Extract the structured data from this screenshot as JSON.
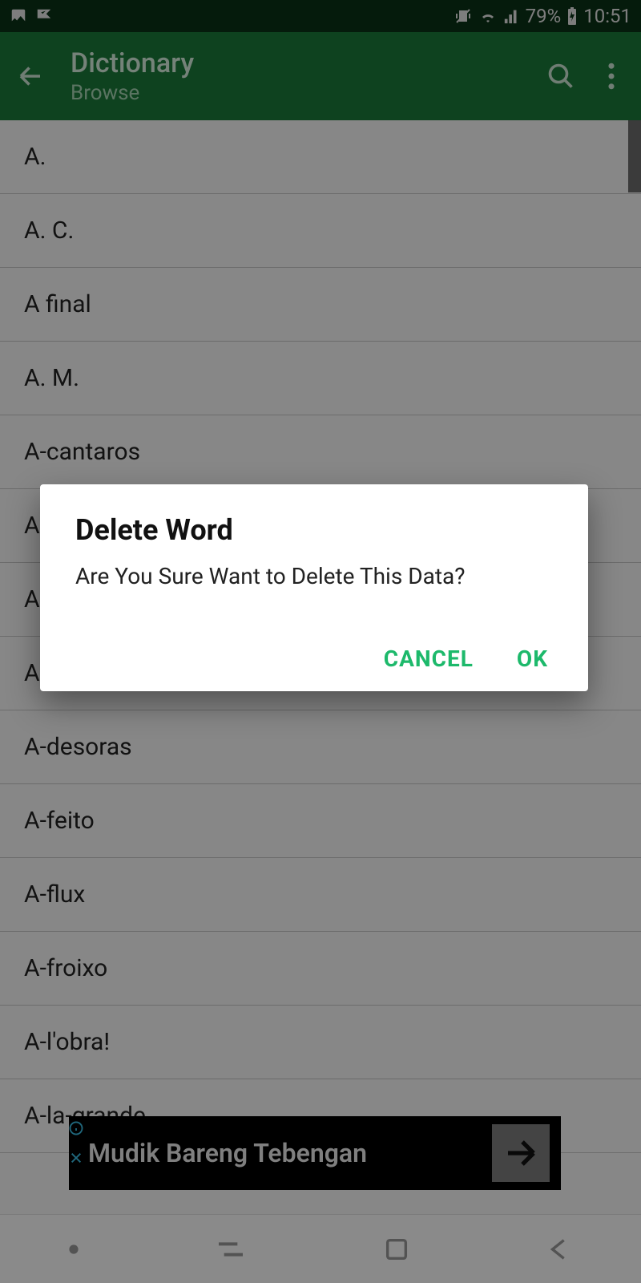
{
  "status": {
    "battery": "79%",
    "time": "10:51"
  },
  "appbar": {
    "title": "Dictionary",
    "subtitle": "Browse"
  },
  "list": {
    "items": [
      "A.",
      "A. C.",
      "A final",
      "A. M.",
      "A-cantaros",
      "A",
      "A",
      "A",
      "A-desoras",
      "A-feito",
      "A-flux",
      "A-froixo",
      "A-l'obra!",
      "A-la-grande"
    ]
  },
  "dialog": {
    "title": "Delete Word",
    "message": "Are You Sure Want to Delete This Data?",
    "cancel": "CANCEL",
    "ok": "OK"
  },
  "ad": {
    "text": "Mudik Bareng Tebengan"
  }
}
